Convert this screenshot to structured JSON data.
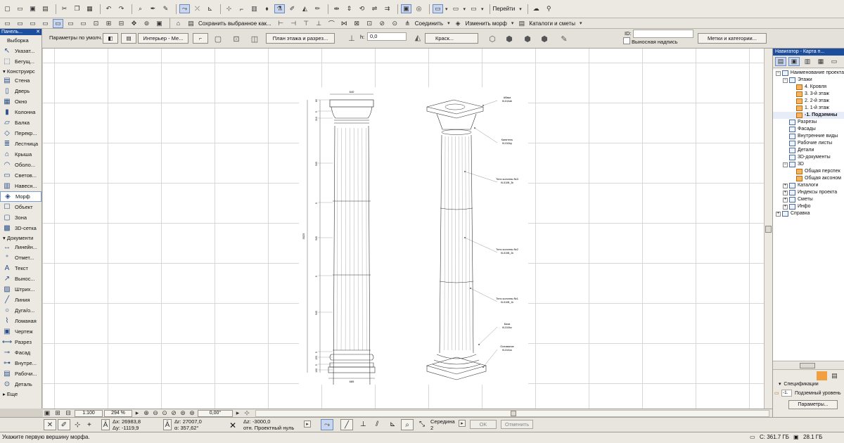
{
  "toolbar1": {
    "go_label": "Перейти"
  },
  "toolbar2": {
    "save_selected_label": "Сохранить выбранное как...",
    "connect_label": "Соединить",
    "change_morph_label": "Изменить морф",
    "catalogs_label": "Каталоги и сметы"
  },
  "infobox": {
    "default_params_label": "Параметры по умолч.",
    "interior_label": "Интерьер - Ме...",
    "plan_section_label": "План этажа и разрез...",
    "h_label": "h:",
    "h_value": "0,0",
    "paint_label": "Краск...",
    "id_label": "ID:",
    "callout_label": "Выносная надпись",
    "marks_label": "Метки и категории..."
  },
  "left_panel": {
    "header": "Панель...",
    "close": "✕",
    "select_label": "Выборка",
    "items_top": [
      {
        "label": "Указат...",
        "icon": "↖"
      },
      {
        "label": "Бегущ...",
        "icon": "⬚"
      }
    ],
    "group_construct": "Конструирс",
    "construct_items": [
      {
        "label": "Стена",
        "icon": "▤"
      },
      {
        "label": "Дверь",
        "icon": "▯"
      },
      {
        "label": "Окно",
        "icon": "▦"
      },
      {
        "label": "Колонна",
        "icon": "▮"
      },
      {
        "label": "Балка",
        "icon": "▱"
      },
      {
        "label": "Перекр...",
        "icon": "◇"
      },
      {
        "label": "Лестница",
        "icon": "≣"
      },
      {
        "label": "Крыша",
        "icon": "⌂"
      },
      {
        "label": "Оболо...",
        "icon": "◠"
      },
      {
        "label": "Светов...",
        "icon": "▭"
      },
      {
        "label": "Навесн...",
        "icon": "▥"
      },
      {
        "label": "Морф",
        "icon": "◈"
      },
      {
        "label": "Объект",
        "icon": "☐"
      },
      {
        "label": "Зона",
        "icon": "▢"
      },
      {
        "label": "3D-сетка",
        "icon": "▩"
      }
    ],
    "group_document": "Документи",
    "document_items": [
      {
        "label": "Линейн...",
        "icon": "↔"
      },
      {
        "label": "Отмет...",
        "icon": "⁺"
      },
      {
        "label": "Текст",
        "icon": "A"
      },
      {
        "label": "Вынос...",
        "icon": "↗"
      },
      {
        "label": "Штрих...",
        "icon": "▨"
      },
      {
        "label": "Линия",
        "icon": "╱"
      },
      {
        "label": "Дуга/о...",
        "icon": "○"
      },
      {
        "label": "Ломаная",
        "icon": "⌇"
      },
      {
        "label": "Чертеж",
        "icon": "▣"
      },
      {
        "label": "Разрез",
        "icon": "⟷"
      },
      {
        "label": "Фасад",
        "icon": "⊸"
      },
      {
        "label": "Внутре...",
        "icon": "⊶"
      },
      {
        "label": "Рабочи...",
        "icon": "▤"
      },
      {
        "label": "Деталь",
        "icon": "⊙"
      }
    ],
    "more_label": "Еще"
  },
  "drawing": {
    "mass_label": "Масса 649 кг",
    "dim_top": "640",
    "dim_bottom": "685",
    "dim_total": "3025",
    "dim_section": "945",
    "dim_small": "60",
    "dim_five": "5",
    "dim_310": "310",
    "dim_130": "130",
    "dim_193": "193",
    "dim_100": "100",
    "labels": [
      {
        "title": "Абака",
        "code": "KL510ab"
      },
      {
        "title": "Капитель",
        "code": "KL510kp"
      },
      {
        "title": "Тело колонны №3",
        "code": "KL510B_3k"
      },
      {
        "title": "Тело колонны №2",
        "code": "KL510B_2k"
      },
      {
        "title": "Тело колонны №1",
        "code": "KL510B_1k"
      },
      {
        "title": "База",
        "code": "KL510bz"
      },
      {
        "title": "Основание",
        "code": "KL510os"
      }
    ]
  },
  "canvas_bar": {
    "scale": "1:100",
    "zoom": "294 %",
    "angle": "0,00°"
  },
  "navigator": {
    "title": "Навигатор - Карта п...",
    "tree": [
      {
        "label": "Наименование проекта",
        "level": 0,
        "exp": "−",
        "icon": "blue"
      },
      {
        "label": "Этажи",
        "level": 1,
        "exp": "−",
        "icon": "blue"
      },
      {
        "label": "4. Кровля",
        "level": 2,
        "icon": "orange"
      },
      {
        "label": "3. 3-й этаж",
        "level": 2,
        "icon": "orange"
      },
      {
        "label": "2. 2-й этаж",
        "level": 2,
        "icon": "orange"
      },
      {
        "label": "1. 1-й этаж",
        "level": 2,
        "icon": "orange"
      },
      {
        "label": "-1. Подземны",
        "level": 2,
        "icon": "orange",
        "current": true
      },
      {
        "label": "Разрезы",
        "level": 1,
        "icon": "blue"
      },
      {
        "label": "Фасады",
        "level": 1,
        "icon": "blue"
      },
      {
        "label": "Внутренние виды",
        "level": 1,
        "icon": "blue"
      },
      {
        "label": "Рабочие листы",
        "level": 1,
        "icon": "blue"
      },
      {
        "label": "Детали",
        "level": 1,
        "icon": "blue"
      },
      {
        "label": "3D-документы",
        "level": 1,
        "icon": "blue"
      },
      {
        "label": "3D",
        "level": 1,
        "exp": "−",
        "icon": "blue"
      },
      {
        "label": "Общая перспек",
        "level": 2,
        "icon": "orange"
      },
      {
        "label": "Общая аксоном",
        "level": 2,
        "icon": "orange"
      },
      {
        "label": "Каталоги",
        "level": 1,
        "exp": "+",
        "icon": "blue"
      },
      {
        "label": "Индексы проекта",
        "level": 1,
        "exp": "+",
        "icon": "blue"
      },
      {
        "label": "Сметы",
        "level": 1,
        "exp": "+",
        "icon": "blue"
      },
      {
        "label": "Инфо",
        "level": 1,
        "exp": "+",
        "icon": "blue"
      },
      {
        "label": "Справка",
        "level": 0,
        "exp": "+",
        "icon": "blue"
      }
    ],
    "spec_label": "Спецификации",
    "level_num": "-1.",
    "level_name": "Подземный уровень",
    "params_label": "Параметры..."
  },
  "coords": {
    "dx_label": "Δx:",
    "dx_value": "26983,8",
    "dy_label": "Δy:",
    "dy_value": "-1119,9",
    "dr_label": "Δr:",
    "dr_value": "27007,0",
    "angle_label": "α:",
    "angle_value": "357,62°",
    "dz_label": "Δz:",
    "dz_value": "-3000,0",
    "zero_label": "отн. Проектный нуль",
    "midpoint_label": "Середина",
    "midpoint_value": "2",
    "ok_label": "OK",
    "cancel_label": "Отменить"
  },
  "status": {
    "message": "Укажите первую вершину морфа.",
    "disk_label": "C: 361.7 ГБ",
    "ram_label": "28.1 ГБ"
  },
  "colors": {
    "accent": "#1d4e9e",
    "folder": "#f4b460"
  }
}
